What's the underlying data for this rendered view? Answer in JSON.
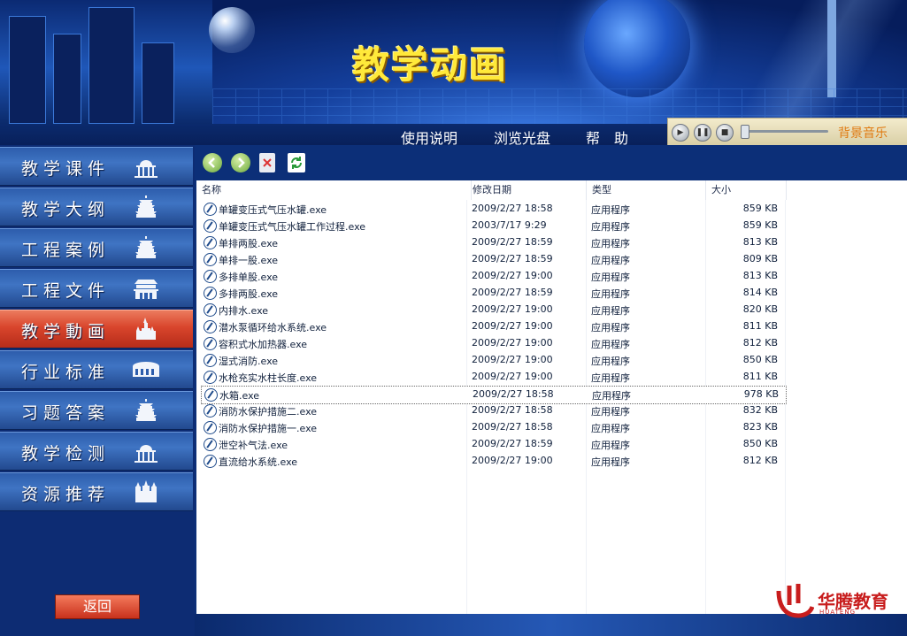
{
  "header": {
    "title": "教学动画"
  },
  "menu": [
    {
      "label": "使用说明"
    },
    {
      "label": "浏览光盘"
    },
    {
      "label": "帮　助"
    }
  ],
  "player": {
    "music_label": "背景音乐",
    "volume_position": 0.0
  },
  "sidebar": {
    "items": [
      {
        "label": "教学课件",
        "active": false
      },
      {
        "label": "教学大纲",
        "active": false
      },
      {
        "label": "工程案例",
        "active": false
      },
      {
        "label": "工程文件",
        "active": false
      },
      {
        "label": "教学動画",
        "active": true
      },
      {
        "label": "行业标准",
        "active": false
      },
      {
        "label": "习题答案",
        "active": false
      },
      {
        "label": "教学检测",
        "active": false
      },
      {
        "label": "资源推荐",
        "active": false
      }
    ],
    "back_label": "返回"
  },
  "filelist": {
    "columns": [
      "名称",
      "修改日期",
      "类型",
      "大小"
    ],
    "rows": [
      {
        "name": "单罐变压式气压水罐.exe",
        "date": "2009/2/27 18:58",
        "type": "应用程序",
        "size": "859 KB"
      },
      {
        "name": "单罐变压式气压水罐工作过程.exe",
        "date": "2003/7/17 9:29",
        "type": "应用程序",
        "size": "859 KB"
      },
      {
        "name": "单排两股.exe",
        "date": "2009/2/27 18:59",
        "type": "应用程序",
        "size": "813 KB"
      },
      {
        "name": "单排一股.exe",
        "date": "2009/2/27 18:59",
        "type": "应用程序",
        "size": "809 KB"
      },
      {
        "name": "多排单股.exe",
        "date": "2009/2/27 19:00",
        "type": "应用程序",
        "size": "813 KB"
      },
      {
        "name": "多排两股.exe",
        "date": "2009/2/27 18:59",
        "type": "应用程序",
        "size": "814 KB"
      },
      {
        "name": "内排水.exe",
        "date": "2009/2/27 19:00",
        "type": "应用程序",
        "size": "820 KB"
      },
      {
        "name": "潜水泵循环给水系统.exe",
        "date": "2009/2/27 19:00",
        "type": "应用程序",
        "size": "811 KB"
      },
      {
        "name": "容积式水加热器.exe",
        "date": "2009/2/27 19:00",
        "type": "应用程序",
        "size": "812 KB"
      },
      {
        "name": "湿式消防.exe",
        "date": "2009/2/27 19:00",
        "type": "应用程序",
        "size": "850 KB"
      },
      {
        "name": "水枪充实水柱长度.exe",
        "date": "2009/2/27 19:00",
        "type": "应用程序",
        "size": "811 KB"
      },
      {
        "name": "水箱.exe",
        "date": "2009/2/27 18:58",
        "type": "应用程序",
        "size": "978 KB",
        "selected": true
      },
      {
        "name": "消防水保护措施二.exe",
        "date": "2009/2/27 18:58",
        "type": "应用程序",
        "size": "832 KB"
      },
      {
        "name": "消防水保护措施一.exe",
        "date": "2009/2/27 18:58",
        "type": "应用程序",
        "size": "823 KB"
      },
      {
        "name": "泄空补气法.exe",
        "date": "2009/2/27 18:59",
        "type": "应用程序",
        "size": "850 KB"
      },
      {
        "name": "直流给水系统.exe",
        "date": "2009/2/27 19:00",
        "type": "应用程序",
        "size": "812 KB"
      }
    ]
  },
  "toolbar": {
    "buttons": [
      "back-arrow-icon",
      "forward-arrow-icon",
      "delete-icon",
      "refresh-icon"
    ]
  },
  "logo": {
    "text": "华腾教育",
    "sub": "HUATENG"
  },
  "colors": {
    "title_yellow": "#ffe93a",
    "nav_blue": "#3f74c3",
    "nav_active_red": "#d9452c",
    "music_orange": "#e07a10",
    "logo_red": "#c81d1d"
  }
}
